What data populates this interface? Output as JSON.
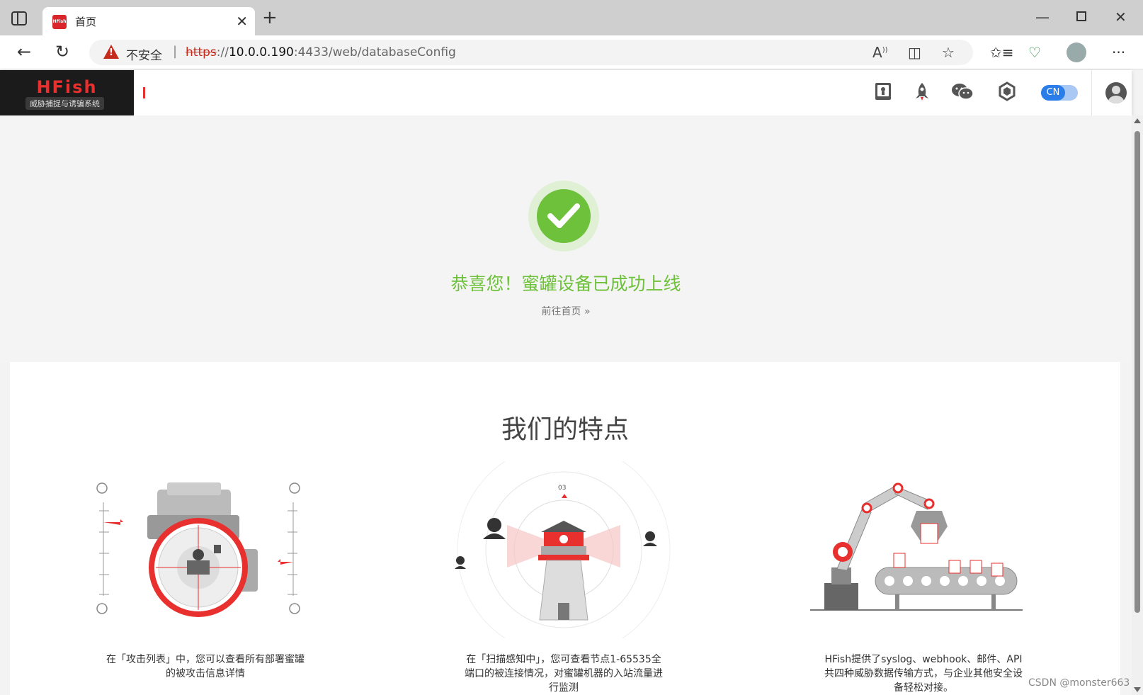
{
  "browser": {
    "tab_title": "首页",
    "tab_favicon_text": "HFish",
    "security_label": "不安全",
    "url_protocol": "https",
    "url_separator": "://",
    "url_host": "10.0.0.190",
    "url_rest": ":4433/web/databaseConfig",
    "icons": [
      "tab-actions-icon",
      "close-icon",
      "new-tab-icon",
      "minimize-icon",
      "maximize-icon",
      "window-close-icon",
      "back-icon",
      "refresh-icon",
      "warning-icon",
      "read-aloud-icon",
      "split-screen-icon",
      "favorite-icon",
      "favorites-icon",
      "health-icon",
      "profile-icon",
      "more-icon"
    ]
  },
  "app": {
    "logo_name": "HFish",
    "logo_subtitle": "威胁捕捉与诱骗系统",
    "lang": "CN",
    "header_icons": [
      "docs-icon",
      "rocket-icon",
      "wechat-icon",
      "hexagon-icon",
      "avatar-icon"
    ]
  },
  "success": {
    "title": "恭喜您！蜜罐设备已成功上线",
    "goto_home": "前往首页",
    "goto_home_arrow": "»",
    "color": "#6ec13a"
  },
  "features": {
    "title": "我们的特点",
    "items": [
      {
        "icon": "camera-lens-illustration",
        "text": "在「攻击列表」中，您可以查看所有部署蜜罐的被攻击信息详情"
      },
      {
        "icon": "watch-tower-illustration",
        "text": "在「扫描感知中」，您可查看节点1-65535全端口的被连接情况，对蜜罐机器的入站流量进行监测"
      },
      {
        "icon": "robot-arm-illustration",
        "text": "HFish提供了syslog、webhook、邮件、API共四种威胁数据传输方式，与企业其他安全设备轻松对接。"
      }
    ]
  },
  "watermark": "CSDN @monster663",
  "colors": {
    "brand_red": "#e8302f",
    "success_green": "#6ec13a",
    "toggle_blue": "#2b7de9"
  }
}
